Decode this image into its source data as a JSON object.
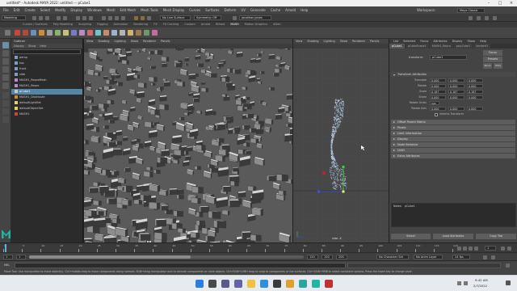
{
  "window": {
    "title": "untitled* - Autodesk MAYA 2022: untitled --- pCube1"
  },
  "menubar": {
    "items": [
      "File",
      "Edit",
      "Create",
      "Select",
      "Modify",
      "Display",
      "Windows",
      "Mesh",
      "Edit Mesh",
      "Mesh Tools",
      "Mesh Display",
      "Curves",
      "Surfaces",
      "Deform",
      "UV",
      "Generate",
      "Cache",
      "Arnold",
      "Help"
    ],
    "workspace_label": "Workspace:",
    "workspace_value": "Maya Classic"
  },
  "statusline": {
    "mode": "Modeling",
    "live_surface": "No Live Surface",
    "symmetry": "Symmetry: Off",
    "user": "jonathan.jones"
  },
  "shelf": {
    "tabs": [
      "Curves / Surfaces",
      "Poly Modeling",
      "Sculpting",
      "Rigging",
      "Animation",
      "Rendering",
      "FX",
      "FX Caching",
      "Custom",
      "Arnold",
      "Bifrost",
      "MASH",
      "Motion Graphics",
      "XGen"
    ]
  },
  "outliner": {
    "title": "Outliner",
    "menu": [
      "Display",
      "Show",
      "Help"
    ],
    "items": [
      {
        "label": "persp",
        "selected": false
      },
      {
        "label": "top",
        "selected": false
      },
      {
        "label": "front",
        "selected": false
      },
      {
        "label": "side",
        "selected": false
      },
      {
        "label": "MASH1_ReproMesh",
        "selected": false
      },
      {
        "label": "MASH1_Repro",
        "selected": false
      },
      {
        "label": "pCube1",
        "selected": true
      },
      {
        "label": "MASH1_Distribute",
        "selected": false
      },
      {
        "label": "defaultLightSet",
        "selected": false
      },
      {
        "label": "defaultObjectSet",
        "selected": false
      },
      {
        "label": "MASH1",
        "selected": false
      }
    ]
  },
  "viewport_left": {
    "menu": [
      "View",
      "Shading",
      "Lighting",
      "Show",
      "Renderer",
      "Panels"
    ],
    "camera_label": "persp"
  },
  "viewport_right": {
    "menu": [
      "View",
      "Shading",
      "Lighting",
      "Show",
      "Renderer",
      "Panels"
    ],
    "camera_label": "side -X"
  },
  "attribute_editor": {
    "menu": [
      "List",
      "Selected",
      "Focus",
      "Attributes",
      "Display",
      "Show",
      "Help"
    ],
    "node_tabs": [
      "pCube1",
      "pCubeShape1",
      "MASH1_Repro",
      "polyCube1",
      "lambert1"
    ],
    "transform_label": "transform:",
    "transform_value": "pCube1",
    "focus_label": "Focus",
    "presets_label": "Presets",
    "show_label": "Show",
    "hide_label": "Hide",
    "section_open": "Transform Attributes",
    "attributes": [
      {
        "label": "Translate",
        "values": [
          "0.000",
          "0.000",
          "0.000"
        ]
      },
      {
        "label": "Rotate",
        "values": [
          "0.000",
          "0.000",
          "0.000"
        ]
      },
      {
        "label": "Scale",
        "values": [
          "0.187",
          "0.187",
          "0.187"
        ]
      },
      {
        "label": "Shear",
        "values": [
          "0.000",
          "0.000",
          "0.000"
        ]
      },
      {
        "label": "Rotate Order",
        "values": [
          "xyz"
        ]
      },
      {
        "label": "Rotate Axis",
        "values": [
          "0.000",
          "0.000",
          "0.000"
        ]
      }
    ],
    "inherits_label": "Inherits Transform",
    "sections_closed": [
      "Pivots",
      "Limit Information",
      "Display",
      "Node Behavior",
      "UUID",
      "Extra Attributes"
    ],
    "pivot_matrix": "Offset Parent Matrix",
    "notes_label": "Notes:",
    "notes_value": "pCube1",
    "buttons": [
      "Select",
      "Load Attributes",
      "Copy Tab"
    ]
  },
  "timeslider": {
    "ticks": [
      "1",
      "5",
      "10",
      "15",
      "20",
      "25",
      "30",
      "35",
      "40",
      "45",
      "50",
      "55",
      "60",
      "65",
      "70",
      "75",
      "80",
      "85",
      "90",
      "95",
      "100",
      "105",
      "110",
      "115",
      "120"
    ],
    "current_frame": "1"
  },
  "rangebar": {
    "start": "1",
    "start_inner": "1",
    "end_inner": "120",
    "end": "120",
    "end2": "200",
    "character_set": "No Character Set",
    "anim_layer": "No Anim Layer",
    "fps": "24 fps"
  },
  "cmdline": {
    "lang": "MEL"
  },
  "helpline": {
    "text": "Move Tool: Use manipulator to move object(s). Ctrl+middle-drag to move components along normals. Shift+drag manipulator axis to extrude components or clone objects. Ctrl+Shift+LMB+drag to snap to components or live surfaces. Ctrl+Shift+RMB to select constraint options. Press the Insert key to change pivot."
  },
  "taskbar": {
    "time": "9:42 AM",
    "date": "2/7/2022"
  },
  "colors": {
    "accent": "#5285a6",
    "maya_logo": "#1fb6a6",
    "viewport_bg": "#5a5a5a"
  }
}
